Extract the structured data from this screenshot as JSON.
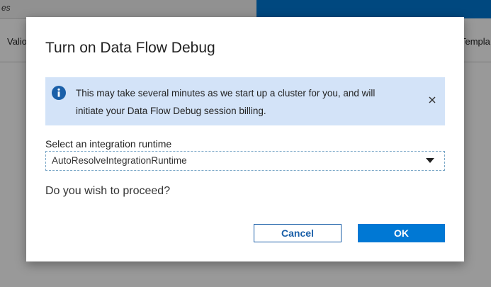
{
  "background": {
    "tab_fragment": "es",
    "toolbar_left_fragment": "Valio",
    "toolbar_right_fragment": "Templa"
  },
  "dialog": {
    "title": "Turn on Data Flow Debug",
    "banner": {
      "icon": "info-icon",
      "line1": "This may take several minutes as we start up a cluster for you, and will",
      "line2": "initiate your Data Flow Debug session billing.",
      "close_icon": "close-icon"
    },
    "runtime": {
      "label": "Select an integration runtime",
      "selected": "AutoResolveIntegrationRuntime",
      "chevron_icon": "chevron-down-icon"
    },
    "question": "Do you wish to proceed?",
    "buttons": {
      "cancel": "Cancel",
      "ok": "OK"
    }
  },
  "colors": {
    "accent": "#0078d4",
    "banner_bg": "#d3e3f8",
    "cancel_text": "#1a5fa8"
  }
}
